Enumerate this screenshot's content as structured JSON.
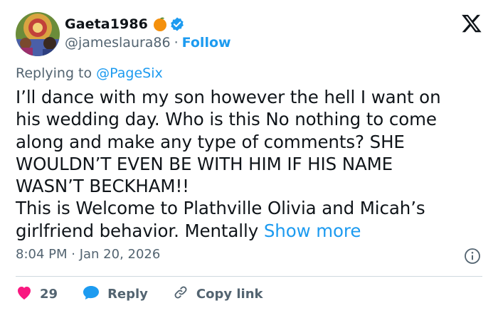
{
  "author": {
    "display_name": "Gaeta1986",
    "handle": "@jameslaura86",
    "separator": "·",
    "follow_label": "Follow",
    "emoji": "orange-emoji",
    "verified_color": "#1d9bf0"
  },
  "reply": {
    "prefix": "Replying to",
    "mention": "@PageSix"
  },
  "body": {
    "lines": [
      "I’ll dance with my son however the hell I want on",
      "his wedding day. Who is this No nothing to come",
      "along and make any type of comments? SHE",
      "WOULDN’T EVEN BE WITH HIM IF HIS NAME",
      "WASN’T BECKHAM!!",
      "This is Welcome to Plathville Olivia and Micah’s",
      "girlfriend behavior. Mentally"
    ],
    "show_more": "Show more"
  },
  "meta": {
    "timestamp": "8:04 PM · Jan 20, 2026"
  },
  "actions": {
    "like_count": "29",
    "reply_label": "Reply",
    "copy_label": "Copy link"
  },
  "colors": {
    "accent": "#1d9bf0",
    "like": "#f91880",
    "muted": "#536471",
    "text": "#0f1419"
  }
}
